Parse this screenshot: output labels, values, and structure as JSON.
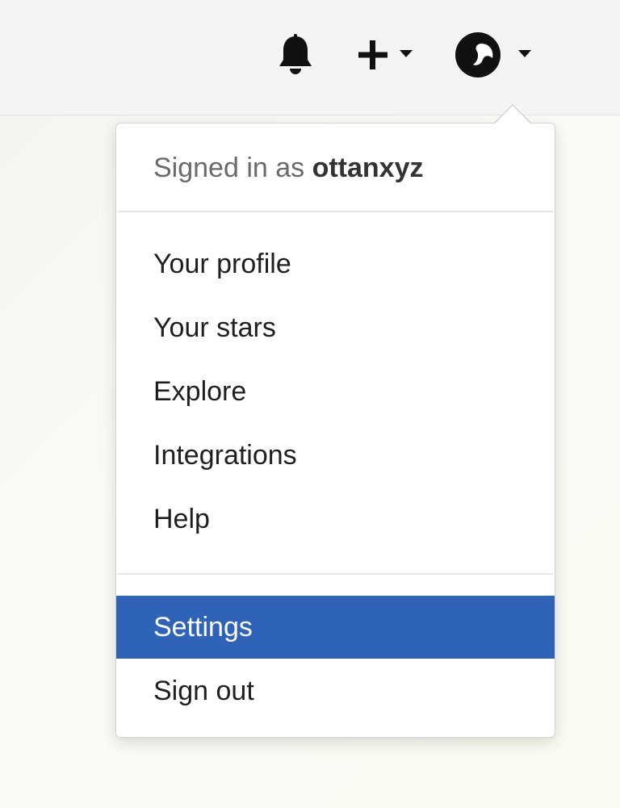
{
  "header": {
    "icons": {
      "notifications": "bell-icon",
      "create": "plus-icon",
      "create_menu": "caret-down-icon",
      "avatar": "avatar-icon",
      "avatar_menu": "caret-down-icon"
    }
  },
  "user_menu": {
    "signed_in_prefix": "Signed in as",
    "username": "ottanxyz",
    "items_group_1": [
      {
        "label": "Your profile"
      },
      {
        "label": "Your stars"
      },
      {
        "label": "Explore"
      },
      {
        "label": "Integrations"
      },
      {
        "label": "Help"
      }
    ],
    "items_group_2": [
      {
        "label": "Settings",
        "highlighted": true
      },
      {
        "label": "Sign out",
        "highlighted": false
      }
    ],
    "highlight_color": "#2e63b8"
  }
}
